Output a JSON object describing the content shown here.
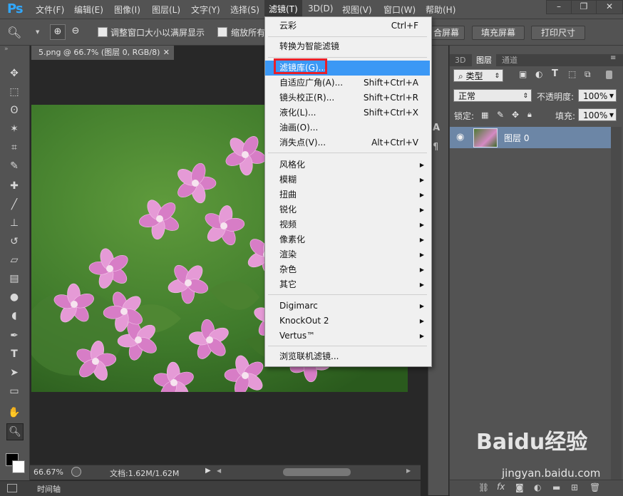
{
  "app": {
    "logo": "Ps"
  },
  "menubar": {
    "items": [
      "文件(F)",
      "编辑(E)",
      "图像(I)",
      "图层(L)",
      "文字(Y)",
      "选择(S)",
      "滤镜(T)",
      "3D(D)",
      "视图(V)",
      "窗口(W)",
      "帮助(H)"
    ],
    "active": "滤镜(T)"
  },
  "options": {
    "resize_label": "调整窗口大小以满屏显示",
    "zoom_all_label": "缩放所有",
    "fit_screen": "合屏幕",
    "fill_screen": "填充屏幕",
    "print_size": "打印尺寸"
  },
  "document": {
    "tab_title": "5.png @ 66.7% (图层 0, RGB/8)",
    "zoom": "66.67%",
    "doc_info": "文档:1.62M/1.62M"
  },
  "timeline": {
    "label": "时间轴"
  },
  "filter_menu": {
    "top_items": [
      {
        "label": "云彩",
        "shortcut": "Ctrl+F"
      },
      {
        "label": "转换为智能滤镜",
        "shortcut": ""
      }
    ],
    "group1": [
      {
        "label": "滤镜库(G)...",
        "shortcut": "",
        "highlighted": true
      },
      {
        "label": "自适应广角(A)...",
        "shortcut": "Shift+Ctrl+A"
      },
      {
        "label": "镜头校正(R)...",
        "shortcut": "Shift+Ctrl+R"
      },
      {
        "label": "液化(L)...",
        "shortcut": "Shift+Ctrl+X"
      },
      {
        "label": "油画(O)...",
        "shortcut": ""
      },
      {
        "label": "消失点(V)...",
        "shortcut": "Alt+Ctrl+V"
      }
    ],
    "submenus": [
      "风格化",
      "模糊",
      "扭曲",
      "锐化",
      "视频",
      "像素化",
      "渲染",
      "杂色",
      "其它"
    ],
    "plugins": [
      "Digimarc",
      "KnockOut 2",
      "Vertus™"
    ],
    "browse": "浏览联机滤镜..."
  },
  "layers_panel": {
    "tabs": [
      "3D",
      "图层",
      "通道"
    ],
    "active_tab": "图层",
    "filter_kind": "类型",
    "blend_mode": "正常",
    "opacity_label": "不透明度:",
    "opacity": "100%",
    "lock_label": "锁定:",
    "fill_label": "填充:",
    "fill": "100%",
    "layers": [
      {
        "name": "图层 0",
        "visible": true
      }
    ]
  },
  "watermark": {
    "brand": "Baidu经验",
    "url": "jingyan.baidu.com"
  },
  "colors": {
    "highlight": "#3b98f5",
    "callout": "#e8202a",
    "layer_selected": "#6c86a6"
  }
}
